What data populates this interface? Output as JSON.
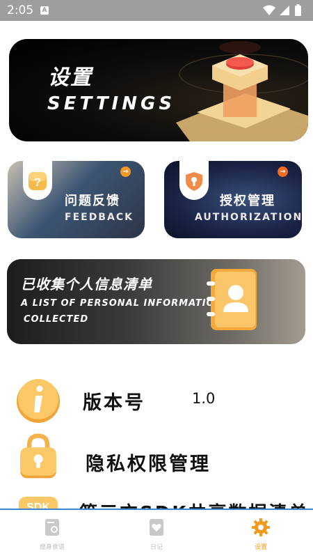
{
  "status_bar": {
    "time": "2:05",
    "notification_badge": "A"
  },
  "banner": {
    "title": "设置",
    "subtitle": "SETTINGS"
  },
  "cards": {
    "feedback": {
      "title": "问题反馈",
      "subtitle": "FEEDBACK",
      "icon": "question-icon"
    },
    "authorization": {
      "title": "授权管理",
      "subtitle": "AUTHORIZATION",
      "icon": "shield-icon"
    },
    "personal_info": {
      "title": "已收集个人信息清单",
      "subtitle_line1": "A LIST OF PERSONAL INFORMATION",
      "subtitle_line2": "COLLECTED",
      "icon": "contact-book-icon"
    }
  },
  "rows": {
    "version": {
      "label": "版本号",
      "value": "1.0",
      "icon": "info-icon"
    },
    "privacy": {
      "label": "隐私权限管理",
      "icon": "lock-icon"
    },
    "sdk": {
      "label": "第三方SDK共享数据清单",
      "icon": "sdk-icon"
    }
  },
  "bottom_nav": {
    "items": [
      {
        "label": "瘦身食谱",
        "icon": "recipe-icon",
        "active": false
      },
      {
        "label": "日记",
        "icon": "diary-icon",
        "active": false
      },
      {
        "label": "设置",
        "icon": "gear-icon",
        "active": true
      }
    ]
  },
  "colors": {
    "accent": "#f29a1d",
    "nav_border": "#3d86d6",
    "status_bar": "#9e9e9e"
  }
}
